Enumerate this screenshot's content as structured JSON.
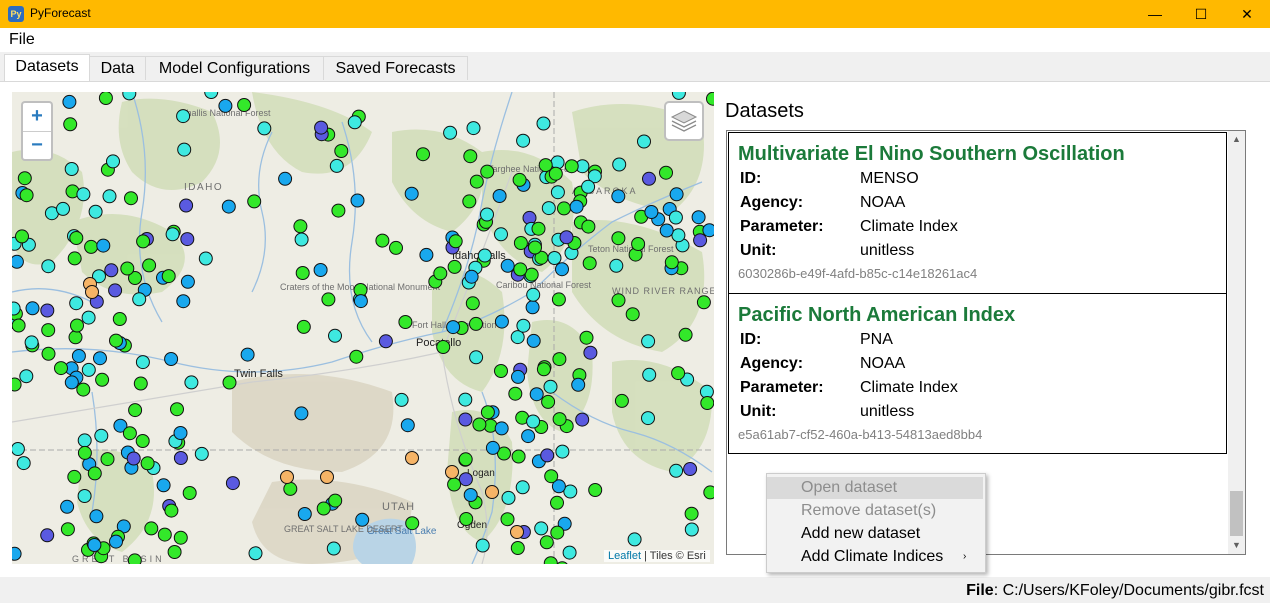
{
  "window": {
    "app_icon_text": "Py",
    "title": "PyForecast",
    "controls": {
      "minimize": "—",
      "maximize": "☐",
      "close": "✕"
    }
  },
  "menubar": {
    "items": [
      {
        "label": "File"
      }
    ]
  },
  "tabs": [
    {
      "label": "Datasets",
      "active": true
    },
    {
      "label": "Data",
      "active": false
    },
    {
      "label": "Model Configurations",
      "active": false
    },
    {
      "label": "Saved Forecasts",
      "active": false
    }
  ],
  "map": {
    "zoom_in": "+",
    "zoom_out": "−",
    "layers_icon": "layers-icon",
    "attribution": {
      "leaflet": "Leaflet",
      "tiles": "| Tiles © Esri"
    },
    "labels": [
      "Challis National Forest",
      "IDAHO",
      "Craters of the Moon National Monument",
      "Twin Falls",
      "Pocatello",
      "Fort Hall Reservation",
      "Idaho Falls",
      "Targhee National Forest",
      "Caribou National Forest",
      "Teton National Forest",
      "WIND RIVER RANGE",
      "ABSAROKA",
      "UTAH",
      "Great Salt Lake",
      "GREAT SALT LAKE DESERT",
      "GREAT BASIN",
      "Logan",
      "Ogden"
    ],
    "marker_colors": {
      "green": "#33e82a",
      "cyan": "#3ee9e0",
      "blue": "#19a8ee",
      "purple": "#5a5ae0",
      "orange": "#f6b466"
    }
  },
  "datasets_panel": {
    "title": "Datasets",
    "cards": [
      {
        "name": "Multivariate El Nino Southern Oscillation",
        "fields": [
          {
            "key": "ID:",
            "value": "MENSO"
          },
          {
            "key": "Agency:",
            "value": "NOAA"
          },
          {
            "key": "Parameter:",
            "value": "Climate Index"
          },
          {
            "key": "Unit:",
            "value": "unitless"
          }
        ],
        "uuid": "6030286b-e49f-4afd-b85c-c14e18261ac4"
      },
      {
        "name": "Pacific North American Index",
        "fields": [
          {
            "key": "ID:",
            "value": "PNA"
          },
          {
            "key": "Agency:",
            "value": "NOAA"
          },
          {
            "key": "Parameter:",
            "value": "Climate Index"
          },
          {
            "key": "Unit:",
            "value": "unitless"
          }
        ],
        "uuid": "e5a61ab7-cf52-460a-b413-54813aed8bb4"
      }
    ],
    "title_color": "#1b7a3a"
  },
  "context_menu": {
    "items": [
      {
        "label": "Open dataset",
        "enabled": false,
        "highlighted": true
      },
      {
        "label": "Remove dataset(s)",
        "enabled": false
      },
      {
        "label": "Add new dataset",
        "enabled": true
      },
      {
        "label": "Add Climate Indices",
        "enabled": true,
        "submenu_arrow": "›"
      }
    ]
  },
  "statusbar": {
    "file_label": "File",
    "file_path": ": C:/Users/KFoley/Documents/gibr.fcst"
  }
}
